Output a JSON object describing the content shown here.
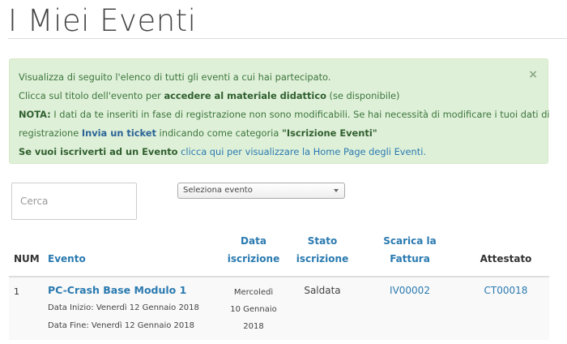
{
  "page": {
    "title": "I Miei Eventi"
  },
  "alert": {
    "line1": "Visualizza di seguito l'elenco di tutti gli eventi a cui hai partecipato.",
    "line2_pre": "Clicca sul titolo dell'evento per ",
    "line2_bold": "accedere al materiale didattico",
    "line2_post": " (se disponibile)",
    "line3_label": "NOTA:",
    "line3_text": " I dati da te inseriti in fase di registrazione non sono modificabili. Se hai necessità di modificare i tuoi dati di",
    "line4_pre": "registrazione ",
    "line4_link": "Invia un ticket",
    "line4_mid": " indicando come categoria ",
    "line4_quote": "\"Iscrizione Eventi\"",
    "line5_bold": "Se vuoi iscriverti ad un Evento",
    "line5_link": " clicca qui per visualizzare la Home Page degli Eventi.",
    "close": "×"
  },
  "search": {
    "placeholder": "Cerca"
  },
  "select": {
    "value": "Seleziona evento"
  },
  "table": {
    "headers": {
      "num": "NUM",
      "evento": "Evento",
      "data_iscrizione_1": "Data",
      "data_iscrizione_2": "iscrizione",
      "stato_1": "Stato",
      "stato_2": "iscrizione",
      "fattura": "Scarica la Fattura",
      "attestato": "Attestato"
    },
    "rows": [
      {
        "num": "1",
        "title": "PC-Crash Base Modulo 1",
        "start": "Data Inizio: Venerdì 12 Gennaio 2018",
        "end": "Data Fine: Venerdì 12 Gennaio 2018",
        "date_1": "Mercoledì",
        "date_2": "10 Gennaio",
        "date_3": "2018",
        "stato": "Saldata",
        "fattura": "IV00002",
        "attestato": "CT00018"
      }
    ]
  },
  "colors": {
    "accent": "#2a7ab0",
    "alert_bg": "#dff0d8",
    "alert_text": "#3c763d"
  }
}
